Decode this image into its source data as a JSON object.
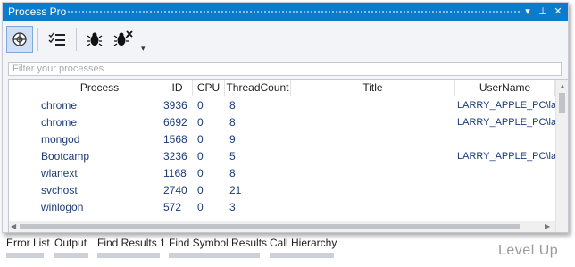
{
  "window": {
    "title": "Process Pro",
    "controls": {
      "dropdown": "▾",
      "pin": "⊥",
      "close": "✕"
    }
  },
  "toolbar": {
    "buttons": [
      {
        "name": "scan-icon",
        "active": true
      },
      {
        "name": "list-check-icon",
        "active": false
      },
      {
        "name": "bug-icon",
        "active": false
      },
      {
        "name": "bug-cross-icon",
        "active": false
      }
    ],
    "overflow": "▾"
  },
  "filter": {
    "placeholder": "Filter your processes",
    "value": ""
  },
  "grid": {
    "columns": [
      "Process",
      "ID",
      "CPU",
      "ThreadCount",
      "Title",
      "UserName"
    ],
    "rows": [
      {
        "process": "chrome",
        "id": "3936",
        "cpu": "0",
        "threads": "8",
        "title": "",
        "user": "LARRY_APPLE_PC\\larr"
      },
      {
        "process": "chrome",
        "id": "6692",
        "cpu": "0",
        "threads": "8",
        "title": "",
        "user": "LARRY_APPLE_PC\\larr"
      },
      {
        "process": "mongod",
        "id": "1568",
        "cpu": "0",
        "threads": "9",
        "title": "",
        "user": ""
      },
      {
        "process": "Bootcamp",
        "id": "3236",
        "cpu": "0",
        "threads": "5",
        "title": "",
        "user": "LARRY_APPLE_PC\\larr"
      },
      {
        "process": "wlanext",
        "id": "1168",
        "cpu": "0",
        "threads": "8",
        "title": "",
        "user": ""
      },
      {
        "process": "svchost",
        "id": "2740",
        "cpu": "0",
        "threads": "21",
        "title": "",
        "user": ""
      },
      {
        "process": "winlogon",
        "id": "572",
        "cpu": "0",
        "threads": "3",
        "title": "",
        "user": ""
      }
    ]
  },
  "bottom_tabs": [
    "Error List",
    "Output",
    "Find Results 1",
    "Find Symbol Results",
    "Call Hierarchy"
  ],
  "watermark": "Level Up",
  "colors": {
    "title_bar": "#0b7bcc",
    "row_text": "#1a3a78",
    "active_button": "#cfe0f5"
  }
}
